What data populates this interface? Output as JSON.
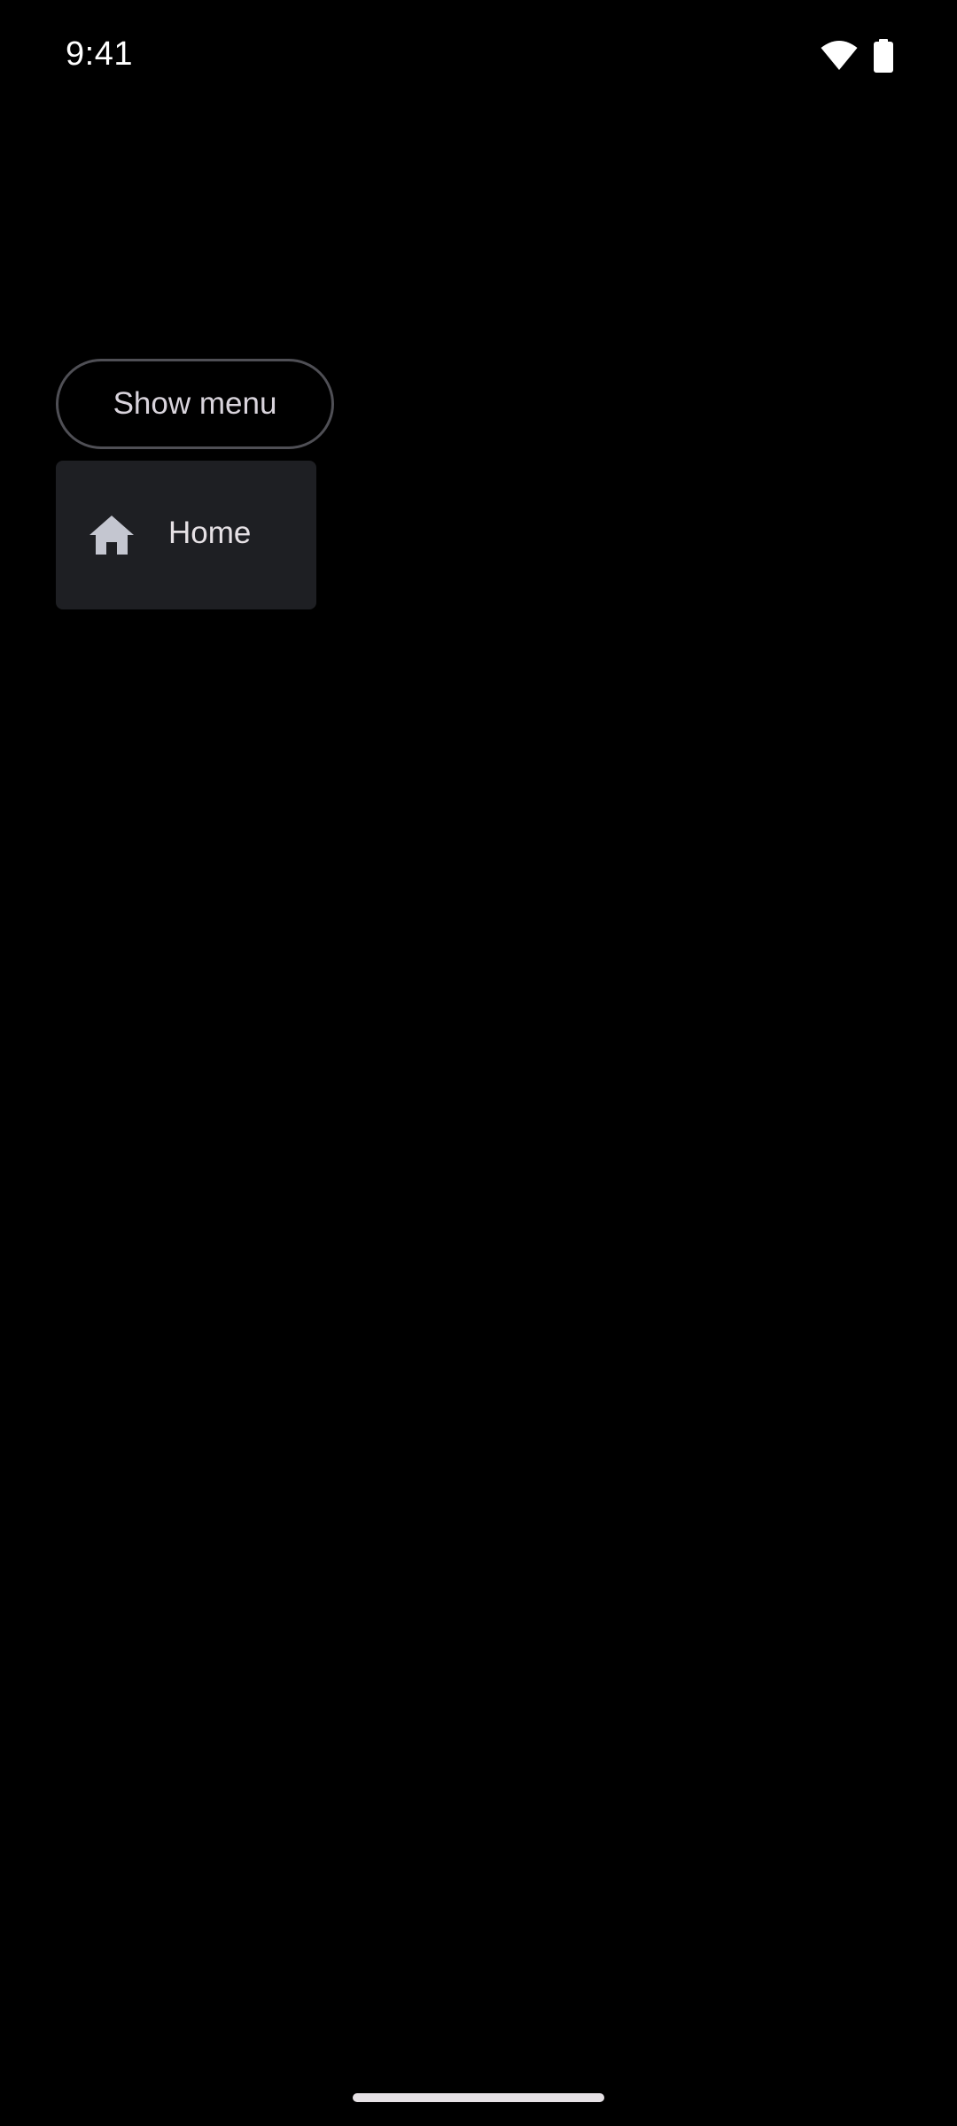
{
  "status_bar": {
    "time": "9:41",
    "icons": [
      "wifi-icon",
      "battery-icon"
    ]
  },
  "show_menu_button": {
    "label": "Show menu"
  },
  "menu": {
    "items": [
      {
        "icon": "home-icon",
        "label": "Home"
      }
    ]
  },
  "colors": {
    "background": "#000000",
    "menu_surface": "#1e1f23",
    "button_outline": "#4f4f55",
    "text": "#e6e1e5"
  }
}
